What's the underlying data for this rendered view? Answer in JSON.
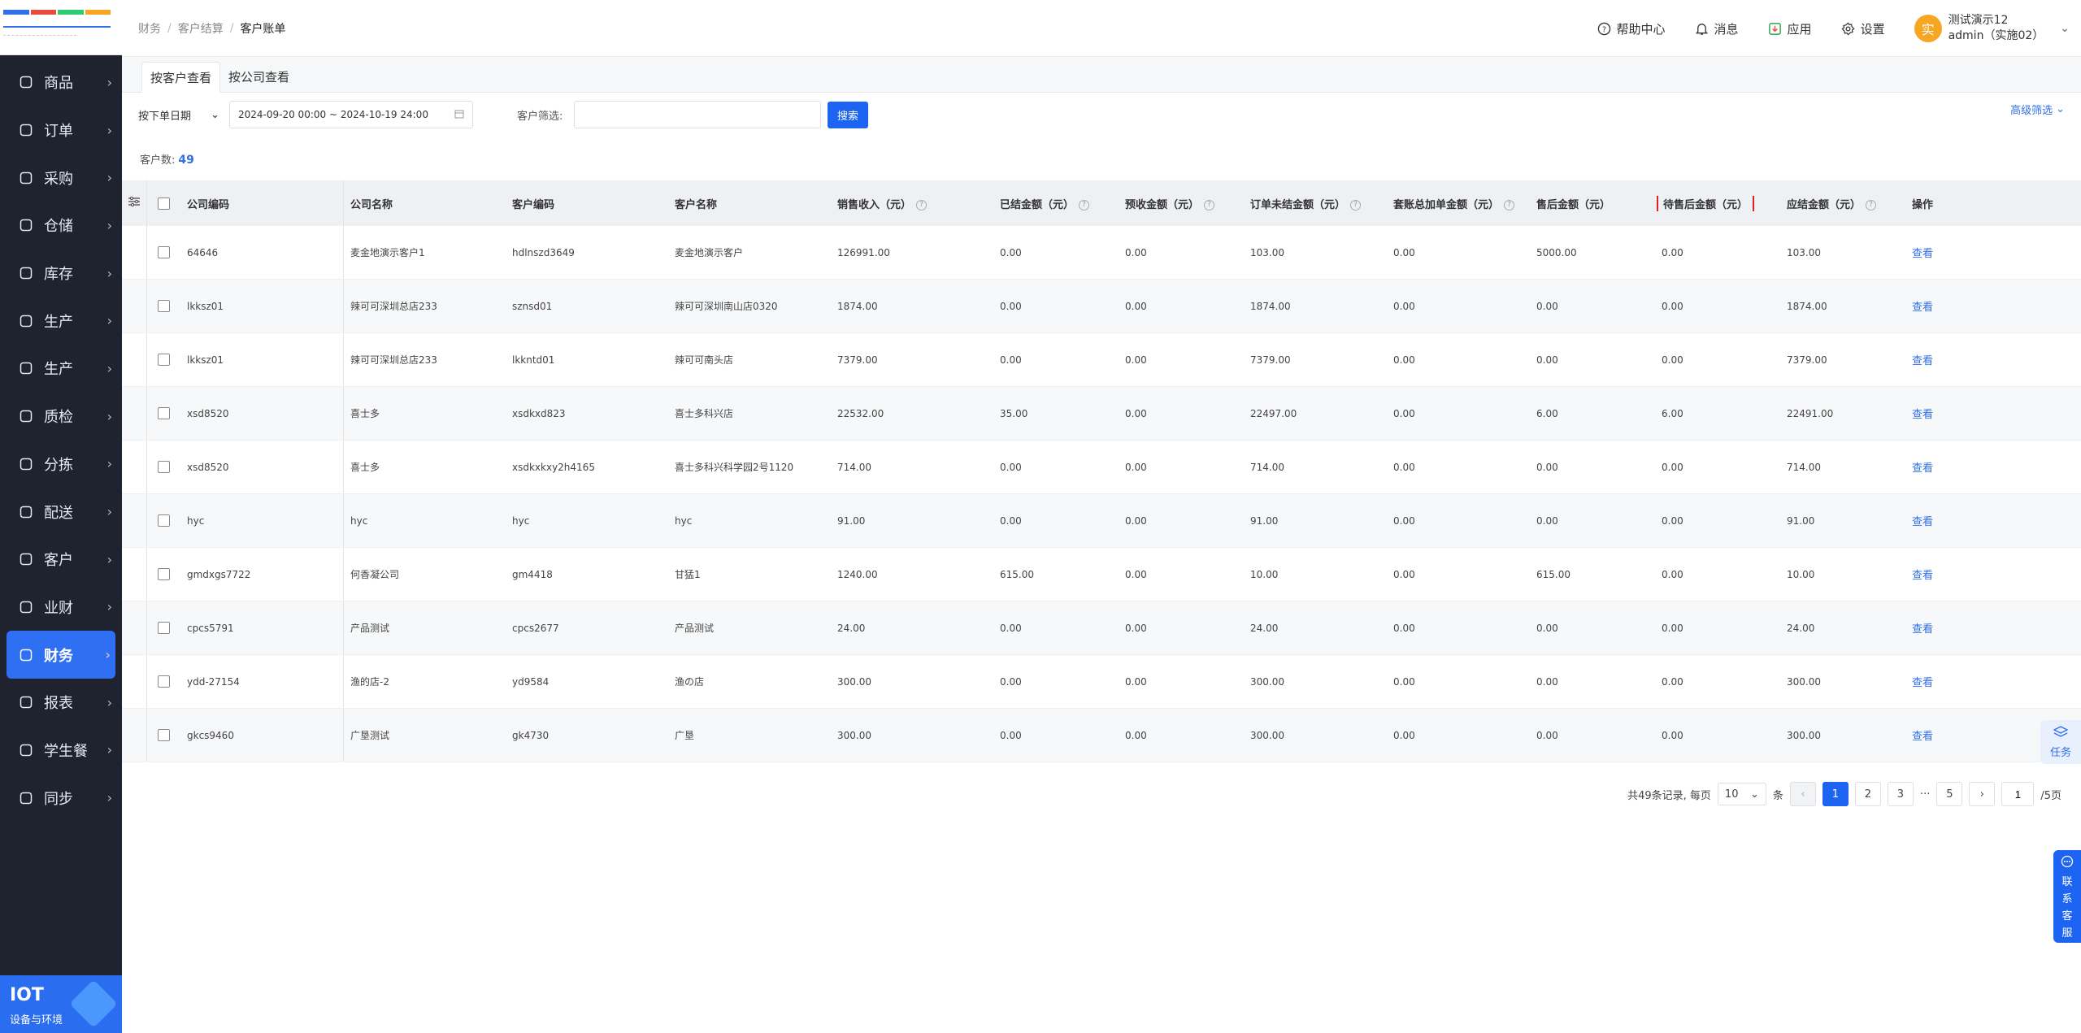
{
  "logo": {
    "colors": [
      "#2f6fe8",
      "#e74c3c",
      "#2ecc71",
      "#f5a623"
    ]
  },
  "sidebar": {
    "items": [
      {
        "label": "商品",
        "icon": "product-icon"
      },
      {
        "label": "订单",
        "icon": "order-icon"
      },
      {
        "label": "采购",
        "icon": "purchase-icon"
      },
      {
        "label": "仓储",
        "icon": "warehouse-icon"
      },
      {
        "label": "库存",
        "icon": "inventory-icon"
      },
      {
        "label": "生产",
        "icon": "production-icon"
      },
      {
        "label": "生产",
        "icon": "production-icon"
      },
      {
        "label": "质检",
        "icon": "shield-icon"
      },
      {
        "label": "分拣",
        "icon": "sort-icon"
      },
      {
        "label": "配送",
        "icon": "truck-icon"
      },
      {
        "label": "客户",
        "icon": "customer-icon"
      },
      {
        "label": "业财",
        "icon": "chart-icon"
      },
      {
        "label": "财务",
        "icon": "finance-icon",
        "active": true
      },
      {
        "label": "报表",
        "icon": "report-icon"
      },
      {
        "label": "学生餐",
        "icon": "meal-icon"
      },
      {
        "label": "同步",
        "icon": "sync-icon"
      }
    ],
    "iot_title": "IOT",
    "iot_subtitle": "设备与环境"
  },
  "breadcrumb": [
    "财务",
    "客户结算",
    "客户账单"
  ],
  "topbar": {
    "help": "帮助中心",
    "messages": "消息",
    "apps": "应用",
    "settings": "设置",
    "avatar_char": "实",
    "user_name": "测试演示12",
    "user_account": "admin（实施02）"
  },
  "tabs": [
    "按客户查看",
    "按公司查看"
  ],
  "filters": {
    "date_type": "按下单日期",
    "date_range": "2024-09-20 00:00 ~ 2024-10-19 24:00",
    "customer_label": "客户筛选:",
    "customer_value": "",
    "search_button": "搜索",
    "advanced": "高级筛选"
  },
  "summary": {
    "label": "客户数:",
    "count": "49"
  },
  "table": {
    "headers": {
      "company_code": "公司编码",
      "company_name": "公司名称",
      "customer_code": "客户编码",
      "customer_name": "客户名称",
      "sales": "销售收入（元）",
      "paid": "已结金额（元）",
      "prepaid": "预收金额（元）",
      "unsettled": "订单未结金额（元）",
      "package": "套账总加单金额（元）",
      "aftersale": "售后金额（元）",
      "pending_aftersale": "待售后金额（元）",
      "due": "应结金额（元）",
      "action": "操作"
    },
    "rows": [
      {
        "company_code": "64646",
        "company_name": "麦金地演示客户1",
        "customer_code": "hdlnszd3649",
        "customer_name": "麦金地演示客户",
        "sales": "126991.00",
        "paid": "0.00",
        "prepaid": "0.00",
        "unsettled": "103.00",
        "package": "0.00",
        "aftersale": "5000.00",
        "pending_aftersale": "0.00",
        "due": "103.00",
        "action": "查看"
      },
      {
        "company_code": "lkksz01",
        "company_name": "辣可可深圳总店233",
        "customer_code": "sznsd01",
        "customer_name": "辣可可深圳南山店0320",
        "sales": "1874.00",
        "paid": "0.00",
        "prepaid": "0.00",
        "unsettled": "1874.00",
        "package": "0.00",
        "aftersale": "0.00",
        "pending_aftersale": "0.00",
        "due": "1874.00",
        "action": "查看"
      },
      {
        "company_code": "lkksz01",
        "company_name": "辣可可深圳总店233",
        "customer_code": "lkkntd01",
        "customer_name": "辣可可南头店",
        "sales": "7379.00",
        "paid": "0.00",
        "prepaid": "0.00",
        "unsettled": "7379.00",
        "package": "0.00",
        "aftersale": "0.00",
        "pending_aftersale": "0.00",
        "due": "7379.00",
        "action": "查看"
      },
      {
        "company_code": "xsd8520",
        "company_name": "喜士多",
        "customer_code": "xsdkxd823",
        "customer_name": "喜士多科兴店",
        "sales": "22532.00",
        "paid": "35.00",
        "prepaid": "0.00",
        "unsettled": "22497.00",
        "package": "0.00",
        "aftersale": "6.00",
        "pending_aftersale": "6.00",
        "due": "22491.00",
        "action": "查看"
      },
      {
        "company_code": "xsd8520",
        "company_name": "喜士多",
        "customer_code": "xsdkxkxy2h4165",
        "customer_name": "喜士多科兴科学园2号1120",
        "sales": "714.00",
        "paid": "0.00",
        "prepaid": "0.00",
        "unsettled": "714.00",
        "package": "0.00",
        "aftersale": "0.00",
        "pending_aftersale": "0.00",
        "due": "714.00",
        "action": "查看"
      },
      {
        "company_code": "hyc",
        "company_name": "hyc",
        "customer_code": "hyc",
        "customer_name": "hyc",
        "sales": "91.00",
        "paid": "0.00",
        "prepaid": "0.00",
        "unsettled": "91.00",
        "package": "0.00",
        "aftersale": "0.00",
        "pending_aftersale": "0.00",
        "due": "91.00",
        "action": "查看"
      },
      {
        "company_code": "gmdxgs7722",
        "company_name": "何香凝公司",
        "customer_code": "gm4418",
        "customer_name": "甘猛1",
        "sales": "1240.00",
        "paid": "615.00",
        "prepaid": "0.00",
        "unsettled": "10.00",
        "package": "0.00",
        "aftersale": "615.00",
        "pending_aftersale": "0.00",
        "due": "10.00",
        "action": "查看"
      },
      {
        "company_code": "cpcs5791",
        "company_name": "产品测试",
        "customer_code": "cpcs2677",
        "customer_name": "产品测试",
        "sales": "24.00",
        "paid": "0.00",
        "prepaid": "0.00",
        "unsettled": "24.00",
        "package": "0.00",
        "aftersale": "0.00",
        "pending_aftersale": "0.00",
        "due": "24.00",
        "action": "查看"
      },
      {
        "company_code": "ydd-27154",
        "company_name": "渔的店-2",
        "customer_code": "yd9584",
        "customer_name": "渔の店",
        "sales": "300.00",
        "paid": "0.00",
        "prepaid": "0.00",
        "unsettled": "300.00",
        "package": "0.00",
        "aftersale": "0.00",
        "pending_aftersale": "0.00",
        "due": "300.00",
        "action": "查看"
      },
      {
        "company_code": "gkcs9460",
        "company_name": "广垦测试",
        "customer_code": "gk4730",
        "customer_name": "广垦",
        "sales": "300.00",
        "paid": "0.00",
        "prepaid": "0.00",
        "unsettled": "300.00",
        "package": "0.00",
        "aftersale": "0.00",
        "pending_aftersale": "0.00",
        "due": "300.00",
        "action": "查看"
      }
    ]
  },
  "pagination": {
    "total_text": "共49条记录, 每页",
    "page_size": "10",
    "unit": "条",
    "pages": [
      "1",
      "2",
      "3",
      "5"
    ],
    "ellipsis": "···",
    "current_input": "1",
    "total_pages_text": "/5页"
  },
  "floating": {
    "task": "任务",
    "service": [
      "联",
      "系",
      "客",
      "服"
    ]
  }
}
